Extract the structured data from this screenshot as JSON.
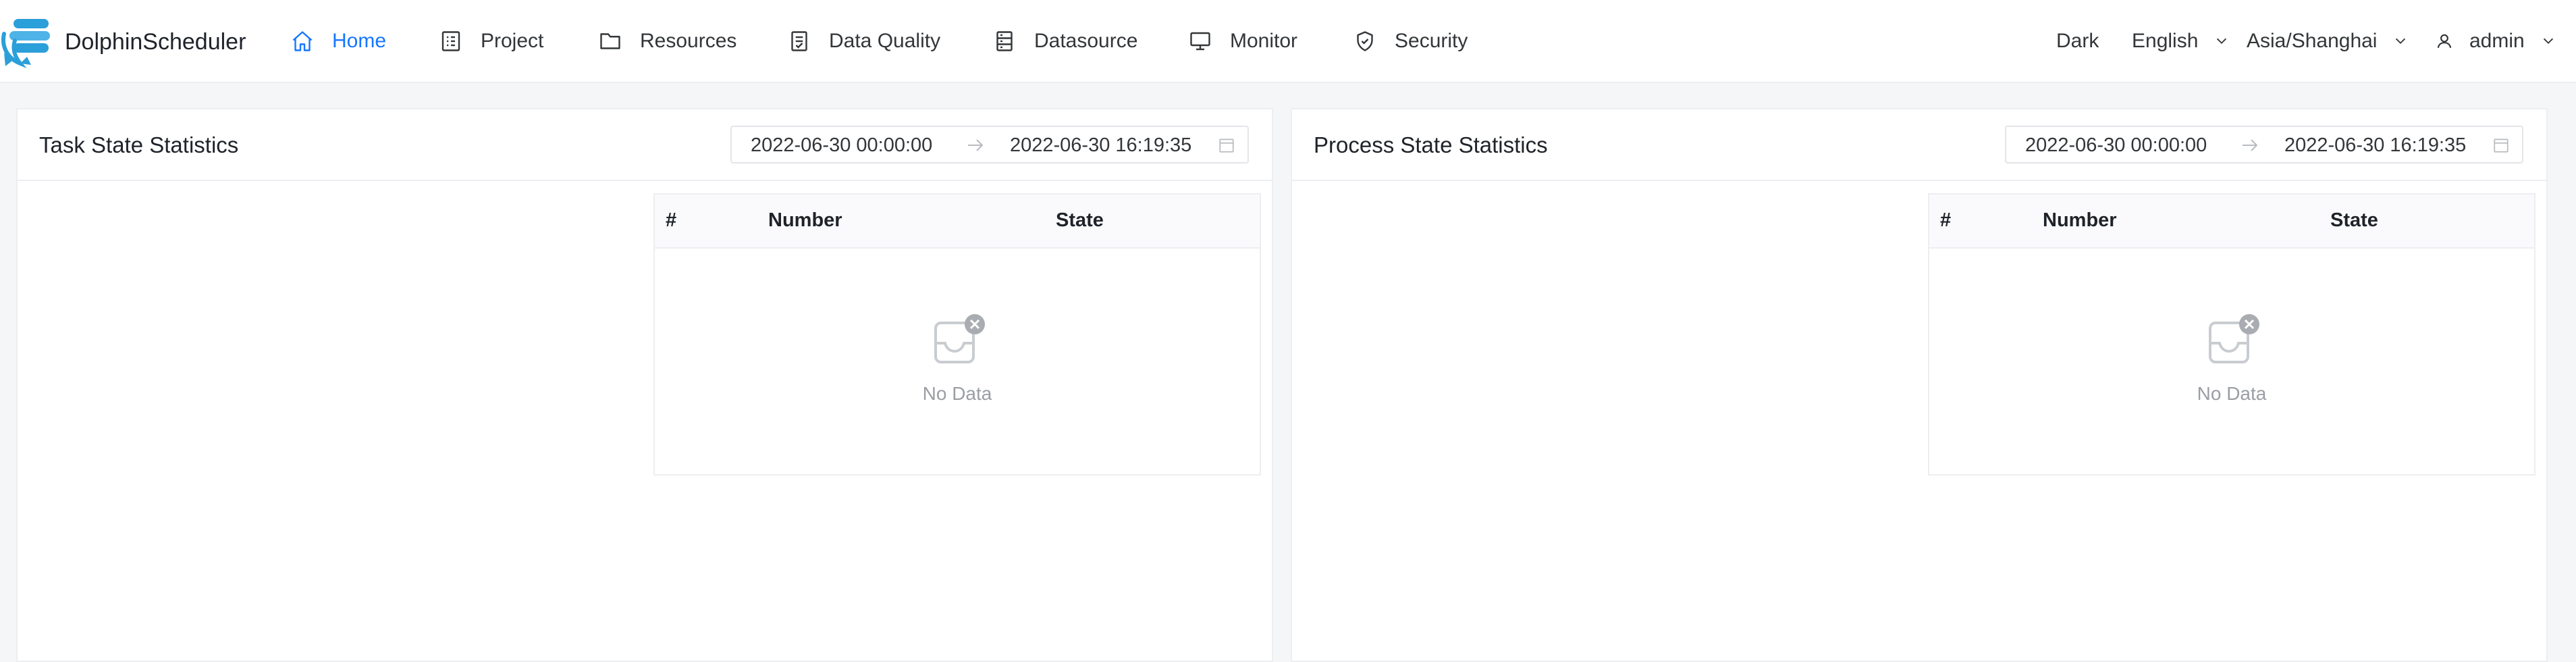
{
  "brand": {
    "name": "DolphinScheduler"
  },
  "nav": {
    "items": [
      {
        "label": "Home",
        "icon": "home-icon",
        "active": true
      },
      {
        "label": "Project",
        "icon": "project-icon"
      },
      {
        "label": "Resources",
        "icon": "folder-icon"
      },
      {
        "label": "Data Quality",
        "icon": "data-quality-icon"
      },
      {
        "label": "Datasource",
        "icon": "database-icon"
      },
      {
        "label": "Monitor",
        "icon": "monitor-icon"
      },
      {
        "label": "Security",
        "icon": "shield-icon"
      }
    ]
  },
  "header_right": {
    "theme": "Dark",
    "language": "English",
    "timezone": "Asia/Shanghai",
    "user": "admin"
  },
  "cards": [
    {
      "title": "Task State Statistics",
      "range_start": "2022-06-30 00:00:00",
      "range_end": "2022-06-30 16:19:35",
      "columns": [
        "#",
        "Number",
        "State"
      ],
      "empty_text": "No Data"
    },
    {
      "title": "Process State Statistics",
      "range_start": "2022-06-30 00:00:00",
      "range_end": "2022-06-30 16:19:35",
      "columns": [
        "#",
        "Number",
        "State"
      ],
      "empty_text": "No Data"
    }
  ],
  "colors": {
    "accent": "#1677ff",
    "logo": "#2b9fd9",
    "background": "#f5f6f8",
    "border": "#eceef1",
    "muted_text": "#9a9ea3"
  }
}
